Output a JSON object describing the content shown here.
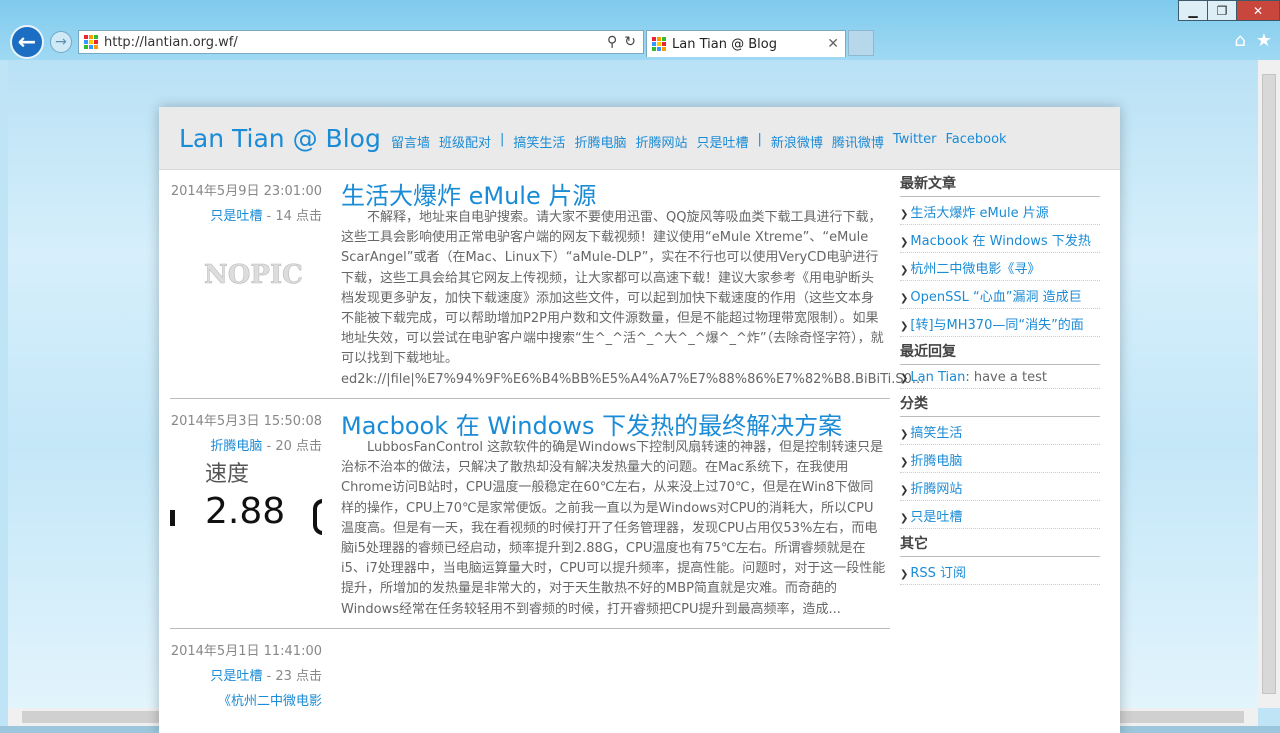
{
  "browser": {
    "url": "http://lantian.org.wf/",
    "tab_title": "Lan Tian @ Blog",
    "window_controls": [
      "minimize-icon",
      "restore-icon",
      "close-icon"
    ],
    "toolbar_icons": [
      "home-icon",
      "favorites-star-icon"
    ]
  },
  "blog": {
    "title": "Lan Tian @ Blog",
    "nav": [
      "留言墙",
      "班级配对",
      "|",
      "搞笑生活",
      "折腾电脑",
      "折腾网站",
      "只是吐槽",
      "|",
      "新浪微博",
      "腾讯微博",
      "Twitter",
      "Facebook"
    ]
  },
  "posts": [
    {
      "date": "2014年5月9日 23:01:00",
      "category": "只是吐槽",
      "views": " - 14 点击",
      "title": "生活大爆炸 eMule 片源",
      "thumb_text": "NOPIC",
      "excerpt": "不解释，地址来自电驴搜索。请大家不要使用迅雷、QQ旋风等吸血类下载工具进行下载，这些工具会影响使用正常电驴客户端的网友下载视频！建议使用“eMule Xtreme”、“eMule ScarAngel”或者（在Mac、Linux下）“aMule-DLP”，实在不行也可以使用VeryCD电驴进行下载，这些工具会给其它网友上传视频，让大家都可以高速下载！建议大家参考《用电驴断头档发现更多驴友，加快下载速度》添加这些文件，可以起到加快下载速度的作用（这些文本身不能被下载完成，可以帮助增加P2P用户数和文件源数量，但是不能超过物理带宽限制）。如果地址失效，可以尝试在电驴客户端中搜索“生^_^活^_^大^_^爆^_^炸”（去除奇怪字符），就可以找到下载地址。ed2k://|file|%E7%94%9F%E6%B4%BB%E5%A4%A7%E7%88%86%E7%82%B8.BiBiTi.S0..."
    },
    {
      "date": "2014年5月3日 15:50:08",
      "category": "折腾电脑",
      "views": " - 20 点击",
      "title": "Macbook 在 Windows 下发热的最终解决方案",
      "thumb_label": "速度",
      "thumb_value": "2.88",
      "excerpt": "LubbosFanControl 这款软件的确是Windows下控制风扇转速的神器，但是控制转速只是治标不治本的做法，只解决了散热却没有解决发热量大的问题。在Mac系统下，在我使用Chrome访问B站时，CPU温度一般稳定在60℃左右，从来没上过70℃，但是在Win8下做同样的操作，CPU上70℃是家常便饭。之前我一直以为是Windows对CPU的消耗大，所以CPU温度高。但是有一天，我在看视频的时候打开了任务管理器，发现CPU占用仅53%左右，而电脑i5处理器的睿频已经启动，频率提升到2.88G，CPU温度也有75℃左右。所谓睿频就是在i5、i7处理器中，当电脑运算量大时，CPU可以提升频率，提高性能。问题时，对于这一段性能提升，所增加的发热量是非常大的，对于天生散热不好的MBP简直就是灾难。而奇葩的Windows经常在任务较轻用不到睿频的时候，打开睿频把CPU提升到最高频率，造成..."
    },
    {
      "date": "2014年5月1日 11:41:00",
      "category": "只是吐槽",
      "views": " - 23 点击",
      "title_partial": "《杭州二中微电影"
    }
  ],
  "sidebar": {
    "recent_title": "最新文章",
    "recent": [
      "生活大爆炸 eMule 片源",
      "Macbook 在 Windows 下发热",
      "杭州二中微电影《寻》",
      "OpenSSL “心血”漏洞 造成巨",
      "[转]与MH370—同“消失”的面"
    ],
    "comments_title": "最近回复",
    "comment_author": "Lan Tian",
    "comment_text": ": have a test",
    "categories_title": "分类",
    "categories": [
      "搞笑生活",
      "折腾电脑",
      "折腾网站",
      "只是吐槽"
    ],
    "other_title": "其它",
    "other": [
      "RSS 订阅"
    ]
  },
  "colors": {
    "link": "#1a8bd6",
    "header_bg": "#eaeaea",
    "window": "#7fcaed"
  }
}
